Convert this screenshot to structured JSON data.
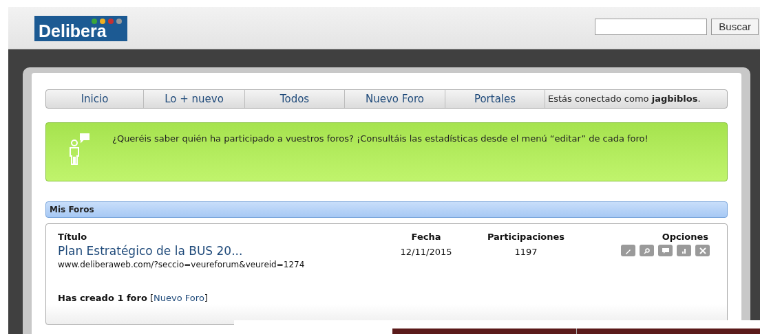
{
  "header": {
    "logo": "Delibera",
    "search": {
      "button": "Buscar"
    }
  },
  "nav": {
    "tabs": [
      {
        "label": "Inicio",
        "selected": false
      },
      {
        "label": "Lo + nuevo",
        "selected": false
      },
      {
        "label": "Todos",
        "selected": false
      },
      {
        "label": "Nuevo Foro",
        "selected": false
      },
      {
        "label": "Portales",
        "selected": false
      }
    ],
    "status": "Estás conectado como **jagbiblos**."
  },
  "notice": "¿Queréis saber quién ha participado a vuestros foros? ¡Consultáis las estadísticas desde el menú “editar” de cada foro!",
  "my_forums": {
    "title": "Mis Foros",
    "columns": [
      "Título",
      "Fecha",
      "Participaciones",
      "Opciones"
    ],
    "rows": [
      {
        "title": "Plan Estratégico de la BUS 20...",
        "url": "www.deliberaweb.com/?seccio=veureforum&veureid=1274",
        "date": "12/11/2015",
        "participations": "1197",
        "options": [
          {
            "kind": "edit"
          },
          {
            "kind": "search"
          },
          {
            "kind": "comment"
          },
          {
            "kind": "chart"
          },
          {
            "kind": "delete"
          }
        ]
      }
    ],
    "summary": {
      "text": "**Has creado 1 foro**",
      "open": "[",
      "link": "Nuevo Foro",
      "close": "]"
    }
  }
}
